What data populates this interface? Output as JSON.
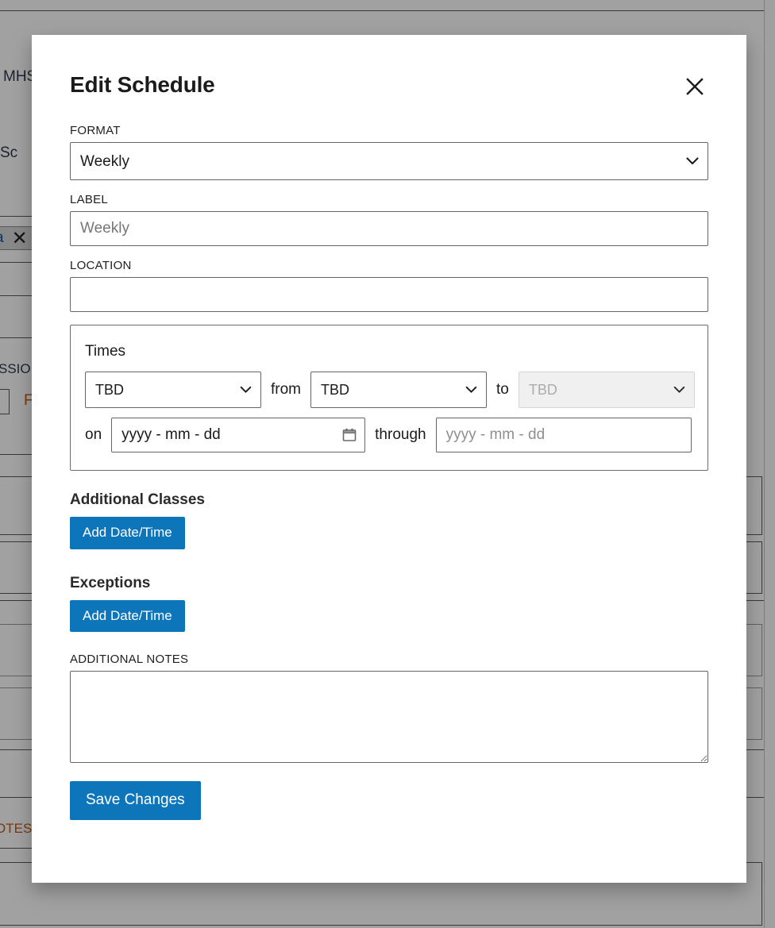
{
  "background": {
    "texts": [
      {
        "id": "mhs",
        "value": "MHS"
      },
      {
        "id": "sc",
        "value": "Sc"
      },
      {
        "id": "session",
        "value": "SSION"
      },
      {
        "id": "f_orange",
        "value": "F"
      },
      {
        "id": "notes",
        "value": "OTES"
      }
    ],
    "tag": {
      "label": "a",
      "close_icon": "close-icon"
    }
  },
  "modal": {
    "title": "Edit Schedule",
    "close_icon": "close-icon",
    "format": {
      "label": "FORMAT",
      "value": "Weekly",
      "options": [
        "Weekly"
      ],
      "caret_icon": "chevron-down-icon"
    },
    "label_field": {
      "label": "LABEL",
      "value": "",
      "placeholder": "Weekly"
    },
    "location_field": {
      "label": "LOCATION",
      "value": "",
      "placeholder": ""
    },
    "times": {
      "heading": "Times",
      "day_select": {
        "value": "TBD",
        "options": [
          "TBD"
        ],
        "caret_icon": "chevron-down-icon"
      },
      "from_word": "from",
      "from_select": {
        "value": "TBD",
        "options": [
          "TBD"
        ],
        "caret_icon": "chevron-down-icon"
      },
      "to_word": "to",
      "to_select": {
        "value": "TBD",
        "options": [
          "TBD"
        ],
        "caret_icon": "chevron-down-icon",
        "disabled": true
      },
      "on_word": "on",
      "on_date": {
        "value": "yyyy - mm - dd",
        "calendar_icon": "calendar-icon"
      },
      "through_word": "through",
      "through_date": {
        "value": "",
        "placeholder": "yyyy - mm - dd"
      }
    },
    "additional_classes": {
      "heading": "Additional Classes",
      "add_button": "Add Date/Time"
    },
    "exceptions": {
      "heading": "Exceptions",
      "add_button": "Add Date/Time"
    },
    "notes": {
      "label": "ADDITIONAL NOTES",
      "value": "",
      "placeholder": ""
    },
    "save_button": "Save Changes"
  },
  "colors": {
    "primary_blue": "#0d76ba",
    "overlay": "rgba(0,0,0,0.37)",
    "border": "#666666",
    "disabled_bg": "#ebebeb"
  }
}
